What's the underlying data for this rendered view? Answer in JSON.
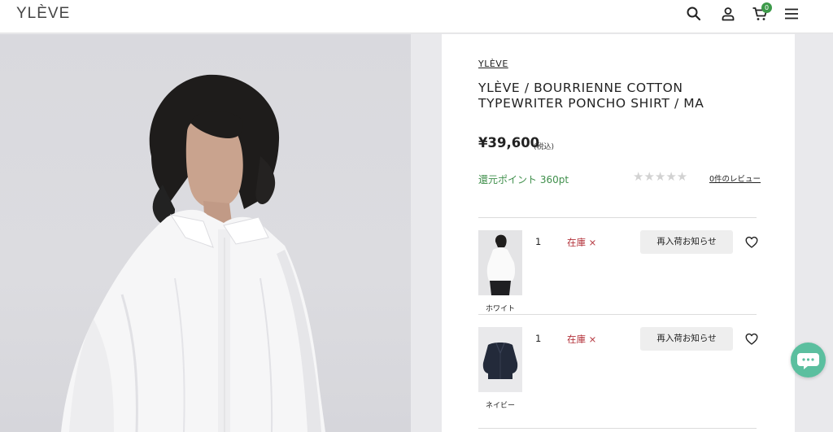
{
  "header": {
    "logo": "YLÈVE",
    "icons": [
      "search-icon",
      "account-icon",
      "cart-icon",
      "menu-icon"
    ],
    "cart_count": "0"
  },
  "product": {
    "brand": "YLÈVE",
    "title": "YLÈVE / BOURRIENNE COTTON TYPEWRITER PONCHO SHIRT / MA",
    "price": "¥39,600",
    "tax_note": "(税込)",
    "points": "還元ポイント 360pt",
    "rating": 0,
    "stars": "★★★★★",
    "reviews": "0件のレビュー"
  },
  "variants": [
    {
      "color": "ホワイト",
      "quantity": "1",
      "stock": "在庫 ×",
      "notify": "再入荷お知らせ"
    },
    {
      "color": "ネイビー",
      "quantity": "1",
      "stock": "在庫 ×",
      "notify": "再入荷お知らせ"
    }
  ],
  "colors": {
    "points_green": "#3f8f4b",
    "stock_red": "#b3323a",
    "badge_green": "#3d9a4a",
    "chat_teal": "#5bbf9f"
  }
}
